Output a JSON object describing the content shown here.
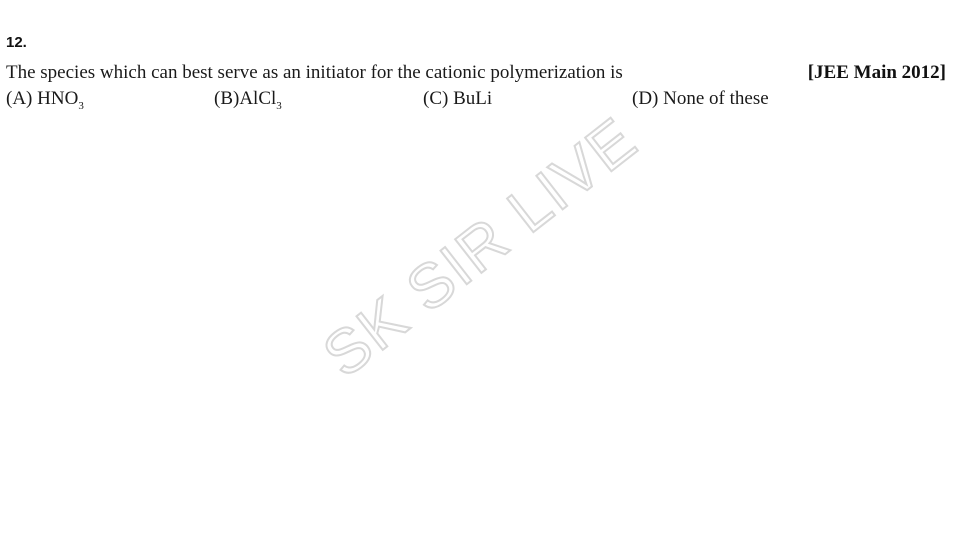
{
  "question": {
    "number": "12.",
    "text": "The species which can best serve as an initiator for the cationic polymerization is",
    "source": "[JEE Main 2012]"
  },
  "options": [
    {
      "label": "(A)",
      "text": "HNO",
      "subscript": "3"
    },
    {
      "label": "(B)",
      "text": "AlCl",
      "subscript": "3"
    },
    {
      "label": "(C)",
      "text": "BuLi",
      "subscript": ""
    },
    {
      "label": "(D)",
      "text": "None of these",
      "subscript": ""
    }
  ],
  "watermark": {
    "text": "SK SIR LIVE"
  }
}
